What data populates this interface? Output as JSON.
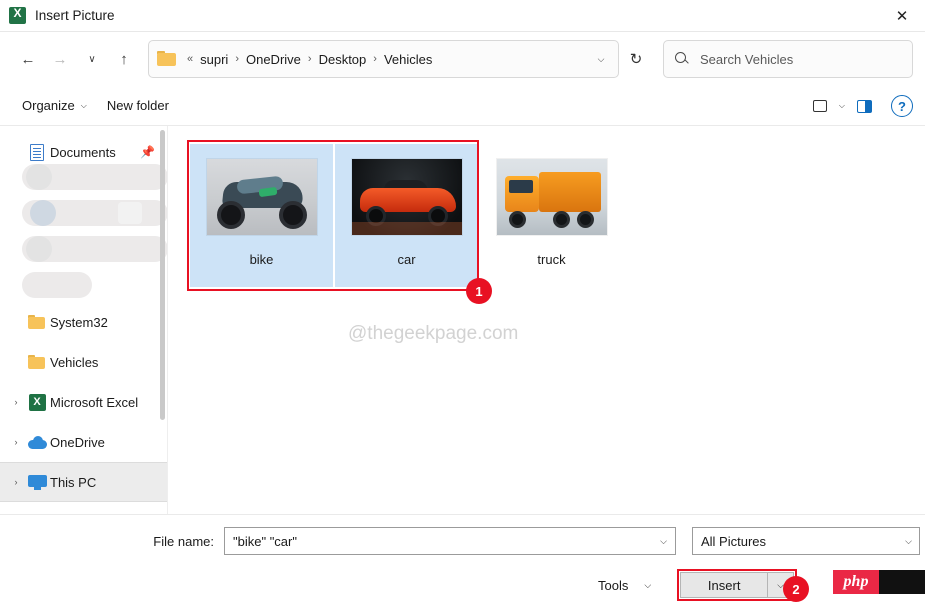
{
  "window": {
    "title": "Insert Picture",
    "app_icon": "excel-icon",
    "close_label": "✕"
  },
  "nav": {
    "back": "←",
    "forward": "→",
    "recent": "∨",
    "up": "↑",
    "refresh": "↻",
    "address_chevron": "⌵",
    "breadcrumbs": [
      {
        "label": "supri",
        "sep": "«"
      },
      {
        "label": "OneDrive",
        "sep": "›"
      },
      {
        "label": "Desktop",
        "sep": "›"
      },
      {
        "label": "Vehicles",
        "sep": "›"
      }
    ],
    "leading_sep": "«"
  },
  "search": {
    "placeholder": "Search Vehicles",
    "icon": "search-icon"
  },
  "commandbar": {
    "organize": "Organize",
    "organize_caret": "⌵",
    "new_folder": "New folder",
    "view_caret": "⌵",
    "help": "?"
  },
  "sidebar": {
    "items": [
      {
        "label": "Documents",
        "icon": "document-icon",
        "chevron": "",
        "pinned": true,
        "selected": false
      },
      {
        "label": "System32",
        "icon": "folder-icon",
        "chevron": "",
        "pinned": false,
        "selected": false
      },
      {
        "label": "Vehicles",
        "icon": "folder-icon",
        "chevron": "",
        "pinned": false,
        "selected": false
      },
      {
        "label": "Microsoft Excel",
        "icon": "excel-icon",
        "chevron": "›",
        "pinned": false,
        "selected": false
      },
      {
        "label": "OneDrive",
        "icon": "cloud-icon",
        "chevron": "›",
        "pinned": false,
        "selected": false
      },
      {
        "label": "This PC",
        "icon": "pc-icon",
        "chevron": "›",
        "pinned": false,
        "selected": true
      }
    ],
    "pin_glyph": "📌"
  },
  "files": {
    "items": [
      {
        "name": "bike",
        "art": "bike",
        "selected": true
      },
      {
        "name": "car",
        "art": "car",
        "selected": true
      },
      {
        "name": "truck",
        "art": "truck",
        "selected": false
      }
    ],
    "watermark": "@thegeekpage.com"
  },
  "annotations": {
    "badge_1": "1",
    "badge_2": "2",
    "highlight_color": "#e81123"
  },
  "bottom": {
    "file_name_label": "File name:",
    "file_name_value": "\"bike\" \"car\"",
    "file_name_caret": "⌵",
    "file_type_value": "All Pictures",
    "file_type_caret": "⌵",
    "tools_label": "Tools",
    "tools_caret": "⌵",
    "insert_label": "Insert",
    "insert_caret": "⌵"
  },
  "overlay": {
    "php_text": "php"
  }
}
